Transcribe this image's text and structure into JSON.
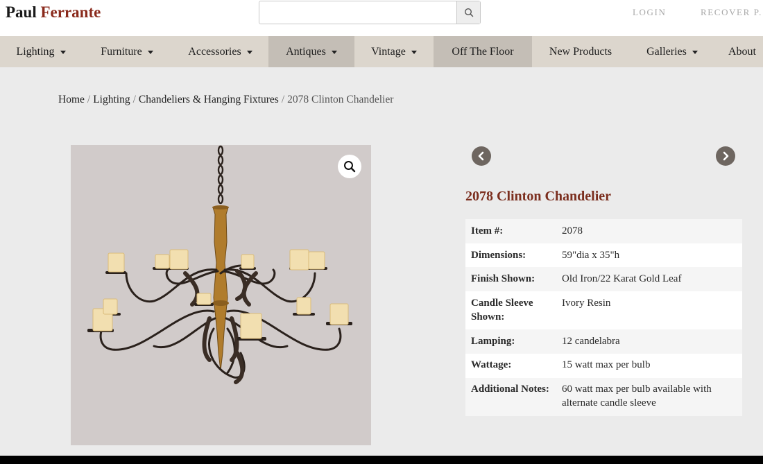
{
  "brand": {
    "name_part1": "Paul",
    "name_part2": "Ferrante"
  },
  "search": {
    "value": "",
    "placeholder": "",
    "icon": "search-icon"
  },
  "header_links": {
    "login": "LOGIN",
    "recover": "RECOVER P."
  },
  "nav": {
    "items": [
      {
        "label": "Lighting",
        "dropdown": true
      },
      {
        "label": "Furniture",
        "dropdown": true
      },
      {
        "label": "Accessories",
        "dropdown": true
      },
      {
        "label": "Antiques",
        "dropdown": true,
        "active": true
      },
      {
        "label": "Vintage",
        "dropdown": true
      },
      {
        "label": "Off The Floor",
        "dropdown": false,
        "active": true
      },
      {
        "label": "New Products",
        "dropdown": false
      },
      {
        "label": "Galleries",
        "dropdown": true
      },
      {
        "label": "About",
        "dropdown": false
      }
    ]
  },
  "breadcrumb": {
    "home": "Home",
    "lighting": "Lighting",
    "category": "Chandeliers & Hanging Fixtures",
    "current": "2078 Clinton Chandelier",
    "separator": "/"
  },
  "product": {
    "title": "2078 Clinton Chandelier",
    "image_alt_icon": "chandelier-image",
    "zoom_icon": "zoom-icon",
    "specs": [
      {
        "label": "Item #:",
        "value": "2078"
      },
      {
        "label": "Dimensions:",
        "value": "59\"dia x 35\"h"
      },
      {
        "label": "Finish Shown:",
        "value": "Old Iron/22 Karat Gold Leaf"
      },
      {
        "label": "Candle Sleeve Shown:",
        "label_line1": "Candle Sleeve",
        "label_line2": "Shown:",
        "value": "Ivory Resin"
      },
      {
        "label": "Lamping:",
        "value": "12 candelabra"
      },
      {
        "label": "Wattage:",
        "value": "15 watt max per bulb"
      },
      {
        "label": "Additional Notes:",
        "value": "60 watt max per bulb available with alternate candle sleeve",
        "value_line1": "60 watt max per bulb available with",
        "value_line2": "alternate candle sleeve"
      }
    ]
  },
  "colors": {
    "brand_red": "#8a2a1c",
    "title_red": "#7b2e1e",
    "nav_bg": "#dcd6cd",
    "nav_active": "#c4beb6",
    "page_bg": "#ebebeb",
    "image_bg": "#d1cbca",
    "arrow": "#6e6660"
  }
}
